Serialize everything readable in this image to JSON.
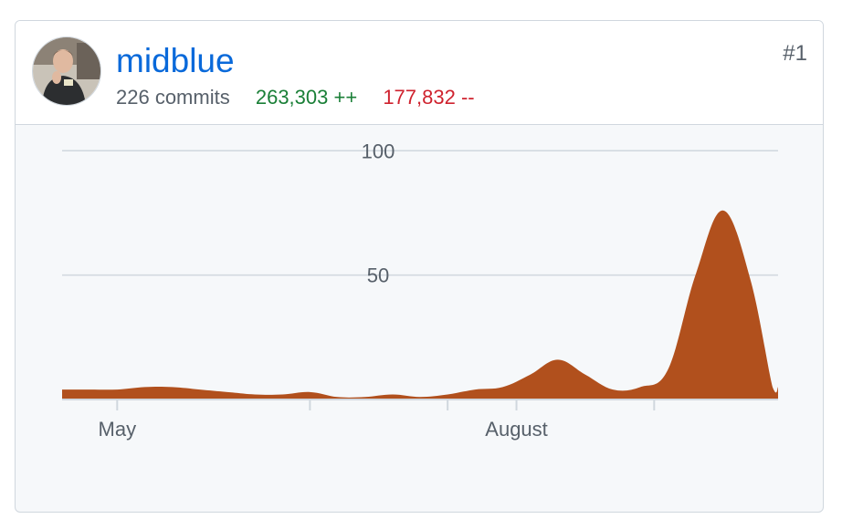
{
  "contributor": {
    "username": "midblue",
    "commits": "226 commits",
    "additions": "263,303 ++",
    "deletions": "177,832 --",
    "rank": "#1",
    "avatar_icon": "user-avatar-photo"
  },
  "colors": {
    "area_fill": "#b1501d",
    "link": "#0969da",
    "additions": "#1a7f37",
    "deletions": "#cf222e",
    "grid": "#d0d7de",
    "background": "#f6f8fa"
  },
  "chart_data": {
    "type": "area",
    "ylim": [
      0,
      110
    ],
    "yticks": [
      {
        "value": 100,
        "label": "100"
      },
      {
        "value": 50,
        "label": "50"
      }
    ],
    "xticks": [
      {
        "x": 2,
        "label": "May"
      },
      {
        "x": 9,
        "label": ""
      },
      {
        "x": 14,
        "label": ""
      },
      {
        "x": 16.5,
        "label": "August"
      },
      {
        "x": 21.5,
        "label": ""
      }
    ],
    "xlim": [
      0,
      26
    ],
    "x": [
      0,
      1,
      2,
      3,
      4,
      5,
      6,
      7,
      8,
      9,
      10,
      11,
      12,
      13,
      14,
      15,
      16,
      17,
      18,
      19,
      20,
      21,
      22,
      23,
      24,
      25,
      25.8,
      26
    ],
    "values": [
      4,
      4,
      4,
      5,
      5,
      4,
      3,
      2,
      2,
      3,
      1,
      1,
      2,
      1,
      2,
      4,
      5,
      10,
      16,
      10,
      4,
      5,
      12,
      50,
      76,
      48,
      5,
      5
    ],
    "grid": true
  }
}
